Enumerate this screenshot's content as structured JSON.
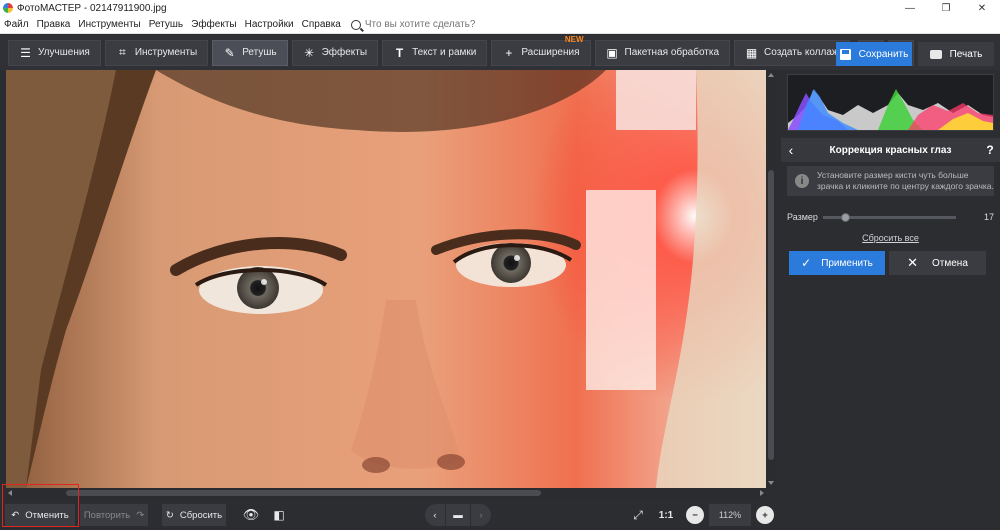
{
  "window": {
    "title": "ФотоМАСТЕР - 02147911900.jpg",
    "minimize_glyph": "—",
    "maximize_glyph": "❐",
    "close_glyph": "✕"
  },
  "menu": {
    "items": [
      "Файл",
      "Правка",
      "Инструменты",
      "Ретушь",
      "Эффекты",
      "Настройки",
      "Справка"
    ],
    "search_placeholder": "Что вы хотите сделать?"
  },
  "toolbar": {
    "tabs": [
      {
        "label": "Улучшения",
        "icon": "sliders-icon"
      },
      {
        "label": "Инструменты",
        "icon": "crop-icon"
      },
      {
        "label": "Ретушь",
        "icon": "brush-icon"
      },
      {
        "label": "Эффекты",
        "icon": "magic-wand-icon"
      },
      {
        "label": "Текст и рамки",
        "icon": "text-icon"
      },
      {
        "label": "Расширения",
        "icon": "plus-icon",
        "badge": "NEW"
      },
      {
        "label": "Пакетная обработка",
        "icon": "batch-icon"
      },
      {
        "label": "Создать коллаж",
        "icon": "collage-icon"
      }
    ],
    "save_label": "Сохранить",
    "print_label": "Печать"
  },
  "panel": {
    "title": "Коррекция красных глаз",
    "help": "?",
    "back": "‹",
    "info_text": "Установите размер кисти чуть больше зрачка и кликните по центру каждого зрачка.",
    "size_label": "Размер",
    "size_value": "17",
    "reset_all": "Сбросить все",
    "apply_label": "Применить",
    "cancel_label": "Отмена"
  },
  "bottom": {
    "undo_label": "Отменить",
    "redo_label": "Повторить",
    "reset_label": "Сбросить",
    "one_to_one": "1:1",
    "zoom_value": "112%"
  },
  "colors": {
    "accent": "#2a7bdc",
    "badge": "#ff8a1f",
    "highlight": "#e0261f"
  }
}
